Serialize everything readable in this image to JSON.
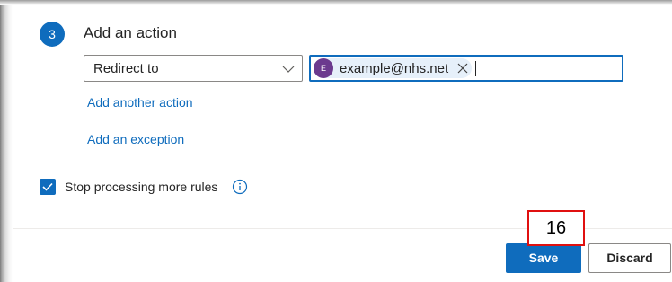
{
  "step": {
    "number": "3",
    "title": "Add an action"
  },
  "action": {
    "selected": "Redirect to"
  },
  "recipient": {
    "initial": "E",
    "email": "example@nhs.net",
    "avatar_color": "#6b3a8e"
  },
  "links": {
    "add_action": "Add another action",
    "add_exception": "Add an exception"
  },
  "stop_processing": {
    "label": "Stop processing more rules",
    "checked": true
  },
  "buttons": {
    "save": "Save",
    "discard": "Discard"
  },
  "marker": {
    "label": "16"
  },
  "colors": {
    "accent": "#0f6cbd",
    "marker_border": "#e01010"
  },
  "icons": [
    "chevron-down-icon",
    "close-icon",
    "checkmark-icon",
    "info-icon"
  ]
}
